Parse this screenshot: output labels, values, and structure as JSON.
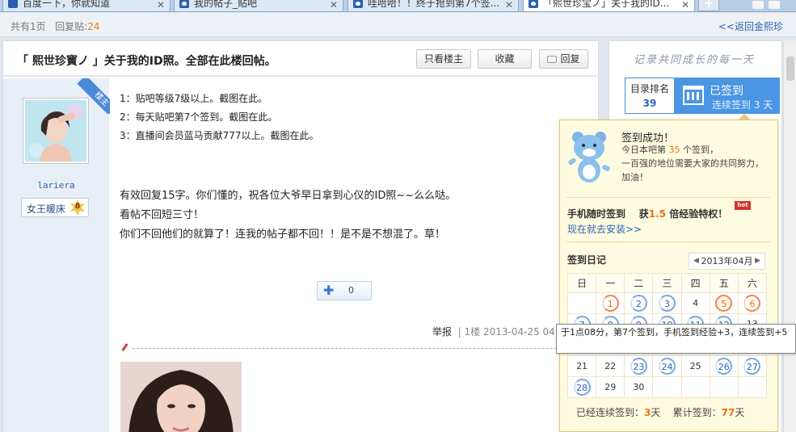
{
  "browser": {
    "tabs": [
      {
        "label": "百度一下，你就知道",
        "icon": "baidu-icon"
      },
      {
        "label": "我的帖子_贴吧",
        "icon": "tieba-paw-icon"
      },
      {
        "label": "哇哈哈！！终于抢到第7个签...",
        "icon": "tieba-paw-icon"
      },
      {
        "label": "「熙世珍宝ノ」关于我的ID...",
        "icon": "tieba-paw-icon"
      }
    ],
    "new_tab_label": "+"
  },
  "infobar": {
    "pages_prefix": "共有1页",
    "reply_prefix": "回复贴:",
    "reply_count": "24",
    "back_link": "<<返回金熙珍"
  },
  "post": {
    "title": "「 熙世珍寳ノ 」关于我的ID照。全部在此楼回帖。",
    "buttons": {
      "only_op": "只看楼主",
      "collect": "收藏",
      "reply": "回复"
    },
    "author": {
      "name": "lariera",
      "badge": "女王暖床",
      "level": "8",
      "ribbon": "楼主"
    },
    "lines": [
      "1：贴吧等级7级以上。截图在此。",
      "2：每天贴吧第7个签到。截图在此。",
      "3：直播间会员蓝马贡献777以上。截图在此。"
    ],
    "lines2": [
      "有效回复15字。你们懂的，祝各位大爷早日拿到心仪的ID照~~么么哒。",
      "看帖不回短三寸！",
      "你们不回他们的就算了！连我的帖子都不回！！是不是不想混了。草！"
    ],
    "like_count": "0",
    "meta": {
      "report": "举报",
      "floor": "1楼",
      "time": "2013-04-25 04:"
    }
  },
  "side": {
    "slogan": "记录共同成长的每一天",
    "rank_label": "目录排名",
    "rank_value": "39",
    "signed_label": "已签到",
    "signed_sub": "连续签到 3 天"
  },
  "popup": {
    "title": "签到成功！",
    "line1_a": "今日本吧第",
    "line1_num": "35",
    "line1_b": "个签到，",
    "line2": "一百强的地位需要大家的共同努力，",
    "line3": "加油！",
    "mobile_a": "手机随时签到",
    "mobile_b": "获",
    "mobile_mult": "1.5",
    "mobile_c": "倍经验特权！",
    "hot": "hot",
    "install": "现在就去安装>>",
    "diary": "签到日记",
    "month": "2013年04月",
    "weekdays": [
      "日",
      "一",
      "二",
      "三",
      "四",
      "五",
      "六"
    ],
    "calendar": [
      [
        "",
        "1",
        "2",
        "3",
        "4",
        "5",
        "6"
      ],
      [
        "7",
        "8",
        "9",
        "10",
        "11",
        "12",
        "13"
      ],
      [
        "14",
        "15",
        "16",
        "17",
        "18",
        "19",
        "20"
      ],
      [
        "21",
        "22",
        "23",
        "24",
        "25",
        "26",
        "27"
      ],
      [
        "28",
        "29",
        "30",
        "",
        "",
        "",
        ""
      ]
    ],
    "streak_label": "已经连续签到：",
    "streak_value": "3",
    "streak_unit": "天",
    "total_label": "累计签到：",
    "total_value": "77",
    "total_unit": "天"
  },
  "tooltip": "于1点08分，第7个签到，手机签到经验+3，连续签到+5",
  "colors": {
    "accent": "#2d64b3",
    "orange": "#e8701c",
    "signed_bg": "#4a95e4",
    "popup_bg": "#fffbe0"
  }
}
